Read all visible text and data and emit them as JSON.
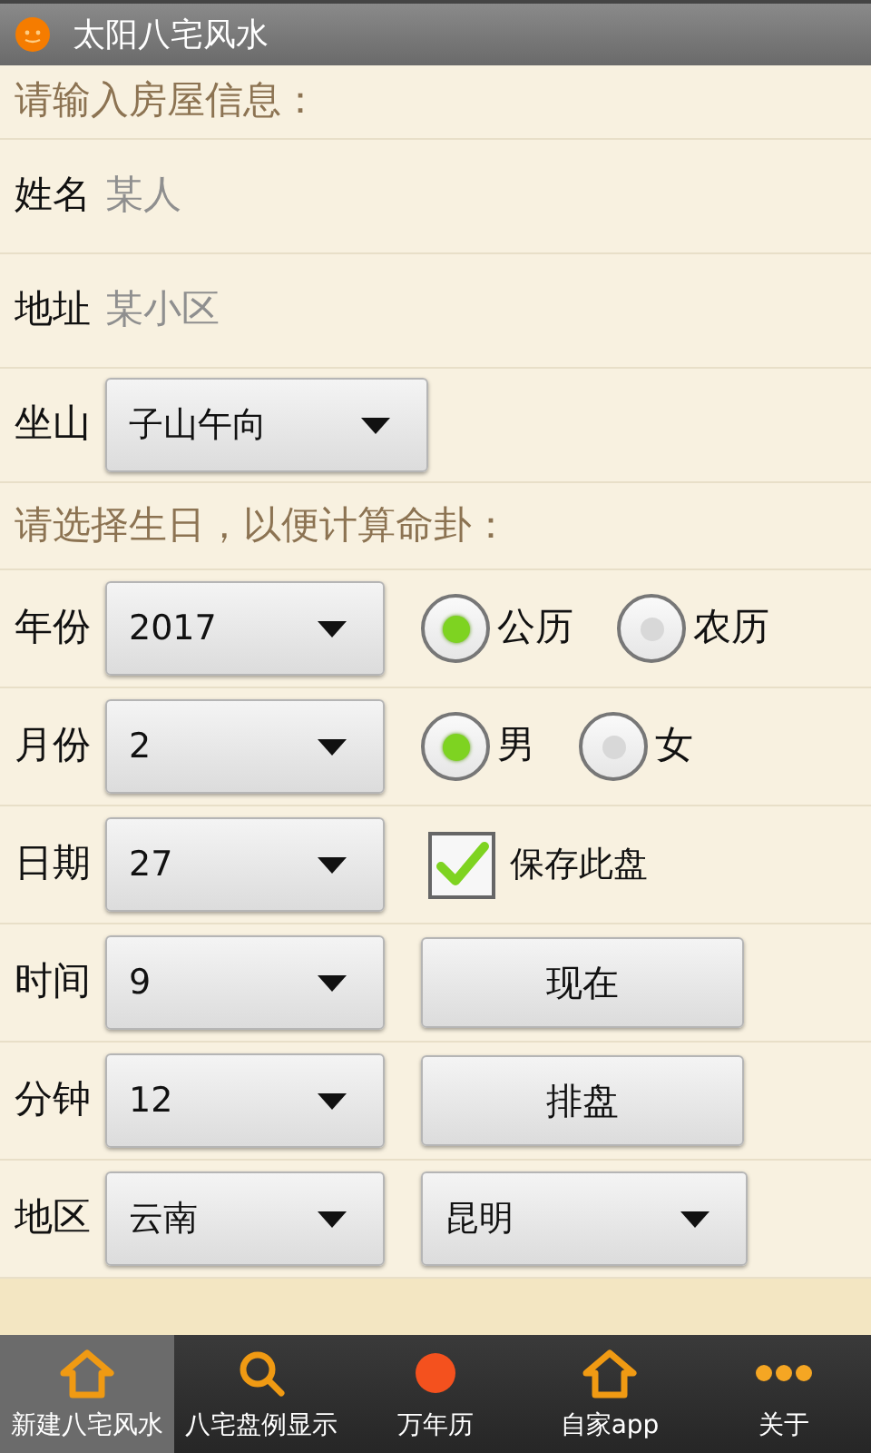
{
  "window": {
    "title": "太阳八宅风水"
  },
  "house_section": {
    "heading": "请输入房屋信息：",
    "rows": [
      {
        "kind": "text",
        "label": "姓名",
        "placeholder": "某人"
      },
      {
        "kind": "text",
        "label": "地址",
        "placeholder": "某小区"
      },
      {
        "kind": "dropdown",
        "label": "坐山",
        "value": "子山午向"
      }
    ]
  },
  "birth_section": {
    "heading": "请选择生日，以便计算命卦：",
    "rows": [
      {
        "label": "年份",
        "value": "2017",
        "side": {
          "kind": "radio",
          "options": [
            {
              "label": "公历",
              "selected": true
            },
            {
              "label": "农历",
              "selected": false
            }
          ]
        }
      },
      {
        "label": "月份",
        "value": "2",
        "side": {
          "kind": "radio",
          "options": [
            {
              "label": "男",
              "selected": true
            },
            {
              "label": "女",
              "selected": false
            }
          ]
        }
      },
      {
        "label": "日期",
        "value": "27",
        "side": {
          "kind": "checkbox",
          "label": "保存此盘",
          "checked": true
        }
      },
      {
        "label": "时间",
        "value": "9",
        "side": {
          "kind": "button",
          "label": "现在"
        }
      },
      {
        "label": "分钟",
        "value": "12",
        "side": {
          "kind": "button",
          "label": "排盘"
        }
      },
      {
        "label": "地区",
        "value": "云南",
        "side": {
          "kind": "dropdown",
          "value": "昆明"
        }
      }
    ]
  },
  "bottom_nav": [
    {
      "label": "新建八宅风水",
      "selected": true
    },
    {
      "label": "八宅盘例显示",
      "selected": false
    },
    {
      "label": "万年历",
      "selected": false
    },
    {
      "label": "自家app",
      "selected": false
    },
    {
      "label": "关于",
      "selected": false
    }
  ]
}
